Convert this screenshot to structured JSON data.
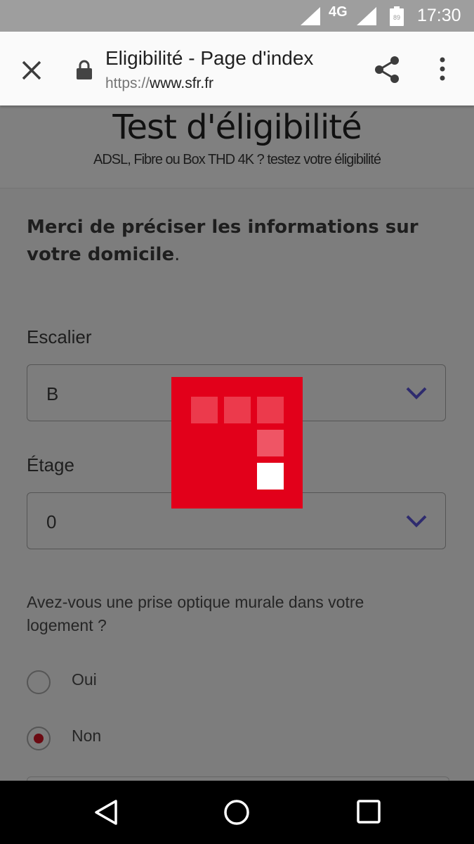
{
  "status_bar": {
    "network": "4G",
    "battery": "89",
    "time": "17:30"
  },
  "toolbar": {
    "title": "Eligibilité - Page d'index",
    "url_scheme": "https://",
    "url_host": "www.sfr.fr"
  },
  "header": {
    "title": "Test d'éligibilité",
    "subtitle": "ADSL, Fibre ou Box THD 4K ? testez votre éligibilité"
  },
  "intro": {
    "bold_text": "Merci de préciser les informations sur votre domicile",
    "suffix": "."
  },
  "form": {
    "escalier": {
      "label": "Escalier",
      "value": "B"
    },
    "etage": {
      "label": "Étage",
      "value": "0"
    },
    "question": "Avez-vous une prise optique murale dans votre logement ?",
    "options": [
      {
        "label": "Oui",
        "selected": false
      },
      {
        "label": "Non",
        "selected": true
      }
    ]
  },
  "colors": {
    "brand_red": "#e2001a",
    "radio_selected": "#6b0a12",
    "chevron": "#2e2b6e"
  },
  "icons": {
    "close": "close-icon",
    "lock": "lock-icon",
    "share": "share-icon",
    "more": "more-vert-icon",
    "chevron": "chevron-down-icon",
    "back": "nav-back-icon",
    "home": "nav-home-icon",
    "recent": "nav-recent-icon"
  }
}
